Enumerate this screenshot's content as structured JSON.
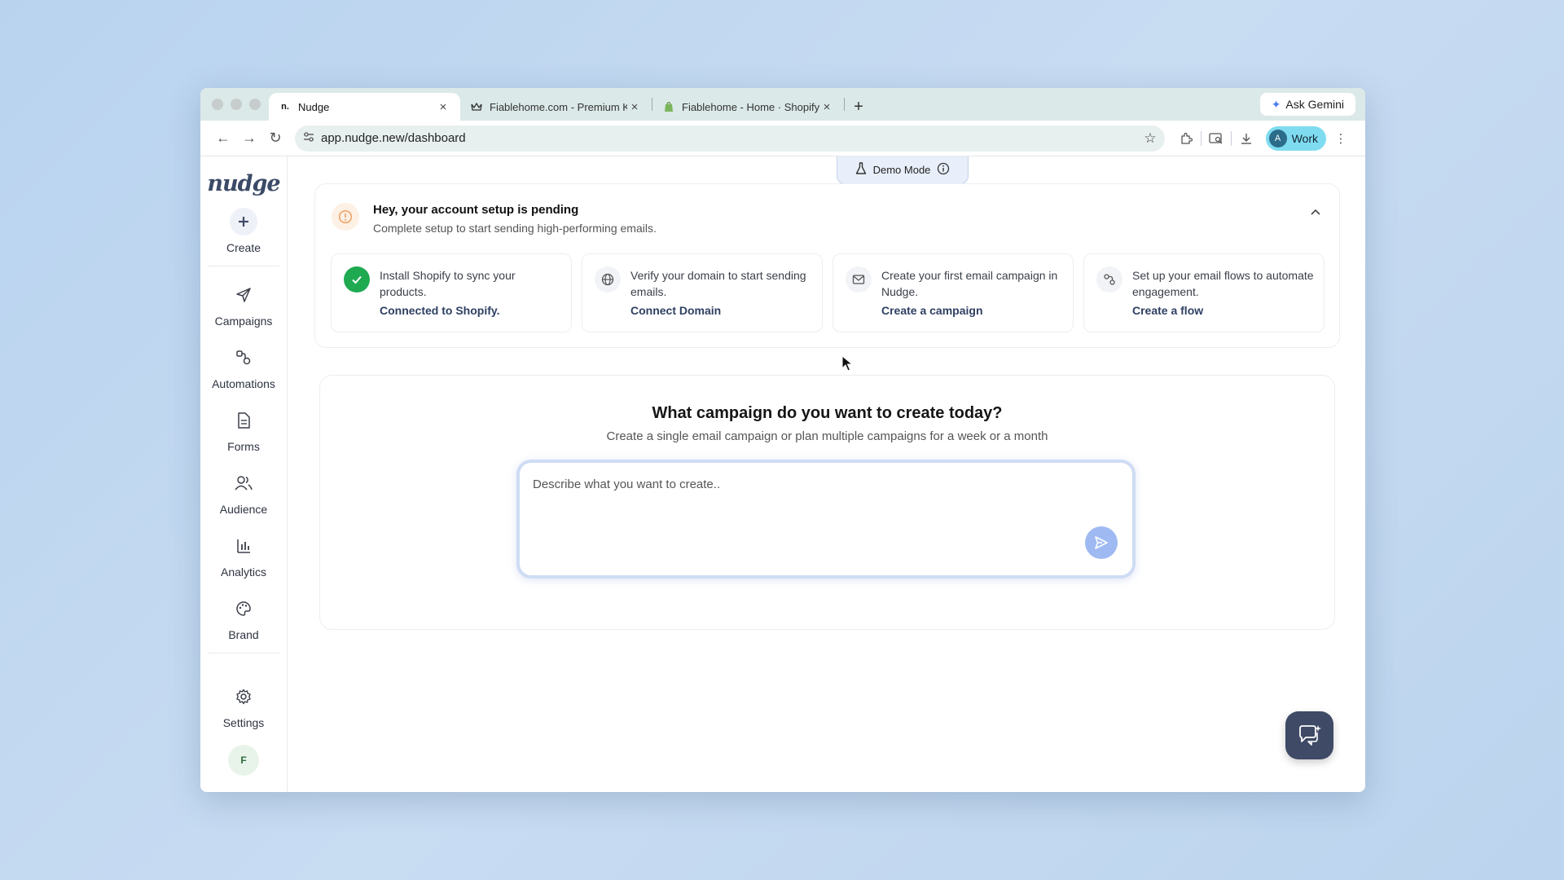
{
  "browser": {
    "tabs": [
      {
        "title": "Nudge",
        "favicon": "n."
      },
      {
        "title": "Fiablehome.com - Premium K",
        "favicon": "crown"
      },
      {
        "title": "Fiablehome - Home · Shopify",
        "favicon": "shopify"
      }
    ],
    "ask_gemini": "Ask Gemini",
    "url": "app.nudge.new/dashboard",
    "profile": {
      "initial": "A",
      "label": "Work"
    }
  },
  "app": {
    "logo": "nudge",
    "nav": {
      "create": "Create",
      "campaigns": "Campaigns",
      "automations": "Automations",
      "forms": "Forms",
      "audience": "Audience",
      "analytics": "Analytics",
      "brand": "Brand",
      "settings": "Settings"
    },
    "user_initial": "F",
    "demo_mode": "Demo Mode",
    "setup": {
      "title": "Hey, your account setup is pending",
      "subtitle": "Complete setup to start sending high-performing emails.",
      "cards": [
        {
          "text": "Install Shopify to sync your products.",
          "link": "Connected to Shopify.",
          "status": "done"
        },
        {
          "text": "Verify your domain to start sending emails.",
          "link": "Connect Domain",
          "status": "pending"
        },
        {
          "text": "Create your first email campaign in Nudge.",
          "link": "Create a campaign",
          "status": "pending"
        },
        {
          "text": "Set up your email flows to automate engagement.",
          "link": "Create a flow",
          "status": "pending"
        }
      ]
    },
    "campaign": {
      "title": "What campaign do you want to create today?",
      "subtitle": "Create a single email campaign or plan multiple campaigns for a week or a month",
      "placeholder": "Describe what you want to create.."
    }
  },
  "colors": {
    "accent": "#3e4a66",
    "success": "#1faa52",
    "warning": "#f0a060",
    "send_button": "#9fbaf2"
  }
}
